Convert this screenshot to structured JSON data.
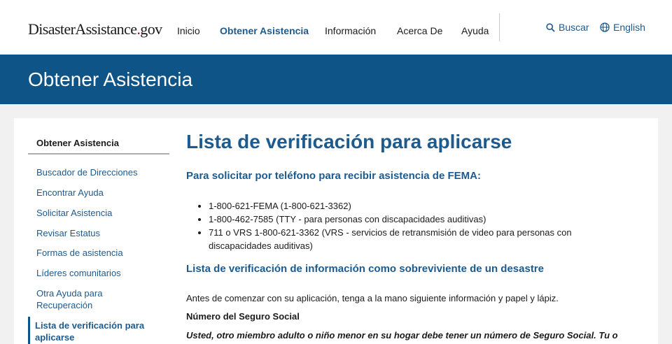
{
  "header": {
    "logo": {
      "part1": "Disaster",
      "part2": "Assistance",
      "dot": ".",
      "part3": "gov"
    },
    "nav": [
      {
        "label": "Inicio"
      },
      {
        "label": "Obtener Asistencia"
      },
      {
        "label": "Información"
      },
      {
        "label": "Acerca De"
      },
      {
        "label": "Ayuda"
      }
    ],
    "search_label": "Buscar",
    "language_label": "English"
  },
  "banner": {
    "title": "Obtener Asistencia"
  },
  "sidebar": {
    "heading": "Obtener Asistencia",
    "items": [
      {
        "label": "Buscador de Direcciones"
      },
      {
        "label": "Encontrar Ayuda"
      },
      {
        "label": "Solicitar Asistencia"
      },
      {
        "label": "Revisar Estatus"
      },
      {
        "label": "Formas de asistencia"
      },
      {
        "label": "Líderes comunitarios"
      },
      {
        "label": "Otra Ayuda para Recuperación"
      },
      {
        "label": "Lista de verificación para aplicarse"
      }
    ]
  },
  "main": {
    "title": "Lista de verificación para aplicarse",
    "phone_heading": "Para solicitar por teléfono para recibir asistencia de FEMA:",
    "phone_items": [
      "1-800-621-FEMA (1-800-621-3362)",
      "1-800-462-7585 (TTY - para personas con discapacidades auditivas)",
      "711 o VRS 1-800-621-3362 (VRS - servicios de retransmisión de video para personas con discapacidades auditivas)"
    ],
    "checklist_heading": "Lista de verificación de información como sobreviviente de un desastre",
    "intro": "Antes de comenzar con su aplicación, tenga a la mano siguiente información y papel y lápiz.",
    "ssn_heading": "Número del Seguro Social",
    "ssn_note": "Usted, otro miembro adulto o niño menor en su hogar debe tener un número de Seguro Social. Tu o"
  }
}
